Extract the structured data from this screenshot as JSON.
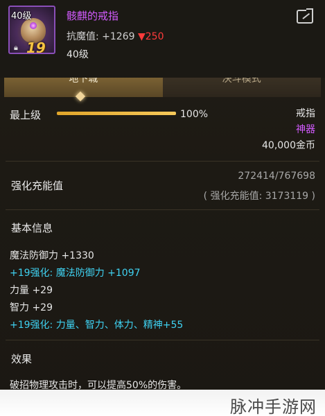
{
  "item": {
    "icon_level_label": "40级",
    "enhance_badge": "19",
    "name": "骸麒的戒指",
    "resist_text": "抗魔值: +1269",
    "resist_drop": "▼250",
    "level_text": "40级"
  },
  "tabs": [
    {
      "label": "地下城",
      "active": true
    },
    {
      "label": "决斗模式",
      "active": false
    }
  ],
  "grade": {
    "label": "最上级",
    "progress_percent": 100,
    "progress_text": "100%"
  },
  "meta": {
    "slot": "戒指",
    "rarity": "神器",
    "price": "40,000金币"
  },
  "charge": {
    "label": "强化充能值",
    "value": "272414/767698",
    "sub": "( 强化充能值: 3173119 )"
  },
  "basic_info": {
    "title": "基本信息",
    "stats": [
      {
        "text": "魔法防御力 +1330",
        "color": "white"
      },
      {
        "text": "+19强化: 魔法防御力 +1097",
        "color": "cyan"
      },
      {
        "text": "力量 +29",
        "color": "white"
      },
      {
        "text": "智力 +29",
        "color": "white"
      },
      {
        "text": "+19强化: 力量、智力、体力、精神+55",
        "color": "cyan"
      }
    ]
  },
  "effect": {
    "title": "效果",
    "text": "破招物理攻击时，可以提高50%的伤害。"
  },
  "watermark": "脉冲手游网",
  "colors": {
    "epic_purple": "#d35bff",
    "enhance_cyan": "#3fd2f2",
    "drop_red": "#ff3b3b",
    "gold": "#f6c343"
  }
}
